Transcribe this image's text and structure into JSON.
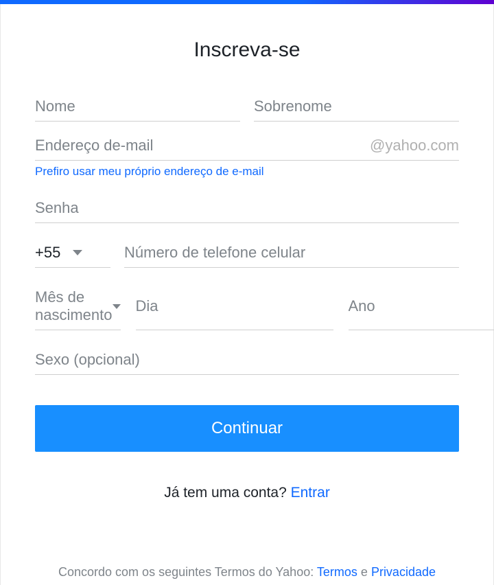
{
  "title": "Inscreva-se",
  "fields": {
    "firstName": {
      "placeholder": "Nome"
    },
    "lastName": {
      "placeholder": "Sobrenome"
    },
    "email": {
      "placeholder": "Endereço de-mail",
      "suffix": "@yahoo.com"
    },
    "ownEmailLink": "Prefiro usar meu próprio endereço de e-mail",
    "password": {
      "placeholder": "Senha"
    },
    "countryCode": "+55",
    "phone": {
      "placeholder": "Número de telefone celular"
    },
    "birthMonth": {
      "label": "Mês de nascimento"
    },
    "birthDay": {
      "placeholder": "Dia"
    },
    "birthYear": {
      "placeholder": "Ano"
    },
    "gender": {
      "placeholder": "Sexo (opcional)"
    }
  },
  "continueButton": "Continuar",
  "signin": {
    "prompt": "Já tem uma conta? ",
    "link": "Entrar"
  },
  "terms": {
    "prefix": "Concordo com os seguintes Termos do Yahoo: ",
    "termsLink": "Termos",
    "and": " e ",
    "privacyLink": "Privacidade"
  }
}
